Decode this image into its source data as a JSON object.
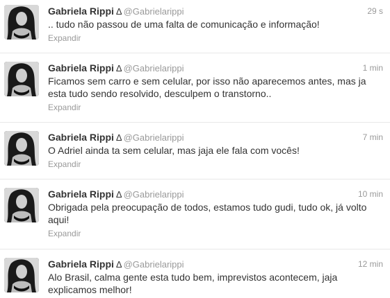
{
  "tweets": [
    {
      "fullname": "Gabriela Rippi",
      "delta": "Δ",
      "screenname": "@Gabrielarippi",
      "time": "29 s",
      "text": ".. tudo não passou de uma falta de comunicação e informação!",
      "expand": "Expandir"
    },
    {
      "fullname": "Gabriela Rippi",
      "delta": "Δ",
      "screenname": "@Gabrielarippi",
      "time": "1 min",
      "text": "Ficamos sem carro e sem celular, por isso não aparecemos antes, mas ja esta tudo sendo resolvido, desculpem o transtorno..",
      "expand": "Expandir"
    },
    {
      "fullname": "Gabriela Rippi",
      "delta": "Δ",
      "screenname": "@Gabrielarippi",
      "time": "7 min",
      "text": "O Adriel ainda ta sem celular, mas jaja ele fala com vocês!",
      "expand": "Expandir"
    },
    {
      "fullname": "Gabriela Rippi",
      "delta": "Δ",
      "screenname": "@Gabrielarippi",
      "time": "10 min",
      "text": "Obrigada pela preocupação de todos, estamos tudo gudi, tudo ok, já volto aqui!",
      "expand": "Expandir"
    },
    {
      "fullname": "Gabriela Rippi",
      "delta": "Δ",
      "screenname": "@Gabrielarippi",
      "time": "12 min",
      "text": "Alo Brasil, calma gente esta tudo bem, imprevistos acontecem, jaja explicamos melhor!",
      "expand": ""
    }
  ]
}
